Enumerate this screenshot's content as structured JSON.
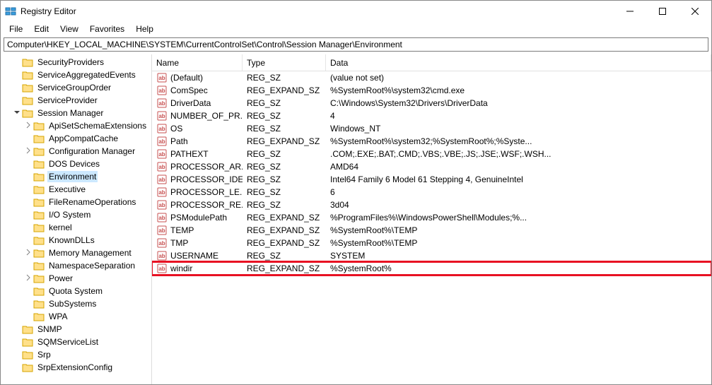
{
  "title": "Registry Editor",
  "menu": {
    "file": "File",
    "edit": "Edit",
    "view": "View",
    "favorites": "Favorites",
    "help": "Help"
  },
  "address": "Computer\\HKEY_LOCAL_MACHINE\\SYSTEM\\CurrentControlSet\\Control\\Session Manager\\Environment",
  "tree": {
    "items": [
      {
        "indent": 1,
        "chev": "",
        "label": "SecurityProviders"
      },
      {
        "indent": 1,
        "chev": "",
        "label": "ServiceAggregatedEvents"
      },
      {
        "indent": 1,
        "chev": "",
        "label": "ServiceGroupOrder"
      },
      {
        "indent": 1,
        "chev": "",
        "label": "ServiceProvider"
      },
      {
        "indent": 1,
        "chev": "open",
        "label": "Session Manager"
      },
      {
        "indent": 2,
        "chev": "closed",
        "label": "ApiSetSchemaExtensions"
      },
      {
        "indent": 2,
        "chev": "",
        "label": "AppCompatCache"
      },
      {
        "indent": 2,
        "chev": "closed",
        "label": "Configuration Manager"
      },
      {
        "indent": 2,
        "chev": "",
        "label": "DOS Devices"
      },
      {
        "indent": 2,
        "chev": "",
        "label": "Environment",
        "selected": true
      },
      {
        "indent": 2,
        "chev": "",
        "label": "Executive"
      },
      {
        "indent": 2,
        "chev": "",
        "label": "FileRenameOperations"
      },
      {
        "indent": 2,
        "chev": "",
        "label": "I/O System"
      },
      {
        "indent": 2,
        "chev": "",
        "label": "kernel"
      },
      {
        "indent": 2,
        "chev": "",
        "label": "KnownDLLs"
      },
      {
        "indent": 2,
        "chev": "closed",
        "label": "Memory Management"
      },
      {
        "indent": 2,
        "chev": "",
        "label": "NamespaceSeparation"
      },
      {
        "indent": 2,
        "chev": "closed",
        "label": "Power"
      },
      {
        "indent": 2,
        "chev": "",
        "label": "Quota System"
      },
      {
        "indent": 2,
        "chev": "",
        "label": "SubSystems"
      },
      {
        "indent": 2,
        "chev": "",
        "label": "WPA"
      },
      {
        "indent": 1,
        "chev": "",
        "label": "SNMP"
      },
      {
        "indent": 1,
        "chev": "",
        "label": "SQMServiceList"
      },
      {
        "indent": 1,
        "chev": "",
        "label": "Srp"
      },
      {
        "indent": 1,
        "chev": "",
        "label": "SrpExtensionConfig"
      }
    ]
  },
  "columns": {
    "name": "Name",
    "type": "Type",
    "data": "Data"
  },
  "values": [
    {
      "name": "(Default)",
      "type": "REG_SZ",
      "data": "(value not set)"
    },
    {
      "name": "ComSpec",
      "type": "REG_EXPAND_SZ",
      "data": "%SystemRoot%\\system32\\cmd.exe"
    },
    {
      "name": "DriverData",
      "type": "REG_SZ",
      "data": "C:\\Windows\\System32\\Drivers\\DriverData"
    },
    {
      "name": "NUMBER_OF_PR...",
      "type": "REG_SZ",
      "data": "4"
    },
    {
      "name": "OS",
      "type": "REG_SZ",
      "data": "Windows_NT"
    },
    {
      "name": "Path",
      "type": "REG_EXPAND_SZ",
      "data": "%SystemRoot%\\system32;%SystemRoot%;%Syste..."
    },
    {
      "name": "PATHEXT",
      "type": "REG_SZ",
      "data": ".COM;.EXE;.BAT;.CMD;.VBS;.VBE;.JS;.JSE;.WSF;.WSH..."
    },
    {
      "name": "PROCESSOR_AR...",
      "type": "REG_SZ",
      "data": "AMD64"
    },
    {
      "name": "PROCESSOR_IDE...",
      "type": "REG_SZ",
      "data": "Intel64 Family 6 Model 61 Stepping 4, GenuineIntel"
    },
    {
      "name": "PROCESSOR_LE...",
      "type": "REG_SZ",
      "data": "6"
    },
    {
      "name": "PROCESSOR_RE...",
      "type": "REG_SZ",
      "data": "3d04"
    },
    {
      "name": "PSModulePath",
      "type": "REG_EXPAND_SZ",
      "data": "%ProgramFiles%\\WindowsPowerShell\\Modules;%..."
    },
    {
      "name": "TEMP",
      "type": "REG_EXPAND_SZ",
      "data": "%SystemRoot%\\TEMP"
    },
    {
      "name": "TMP",
      "type": "REG_EXPAND_SZ",
      "data": "%SystemRoot%\\TEMP"
    },
    {
      "name": "USERNAME",
      "type": "REG_SZ",
      "data": "SYSTEM"
    },
    {
      "name": "windir",
      "type": "REG_EXPAND_SZ",
      "data": "%SystemRoot%",
      "highlight": true
    }
  ]
}
